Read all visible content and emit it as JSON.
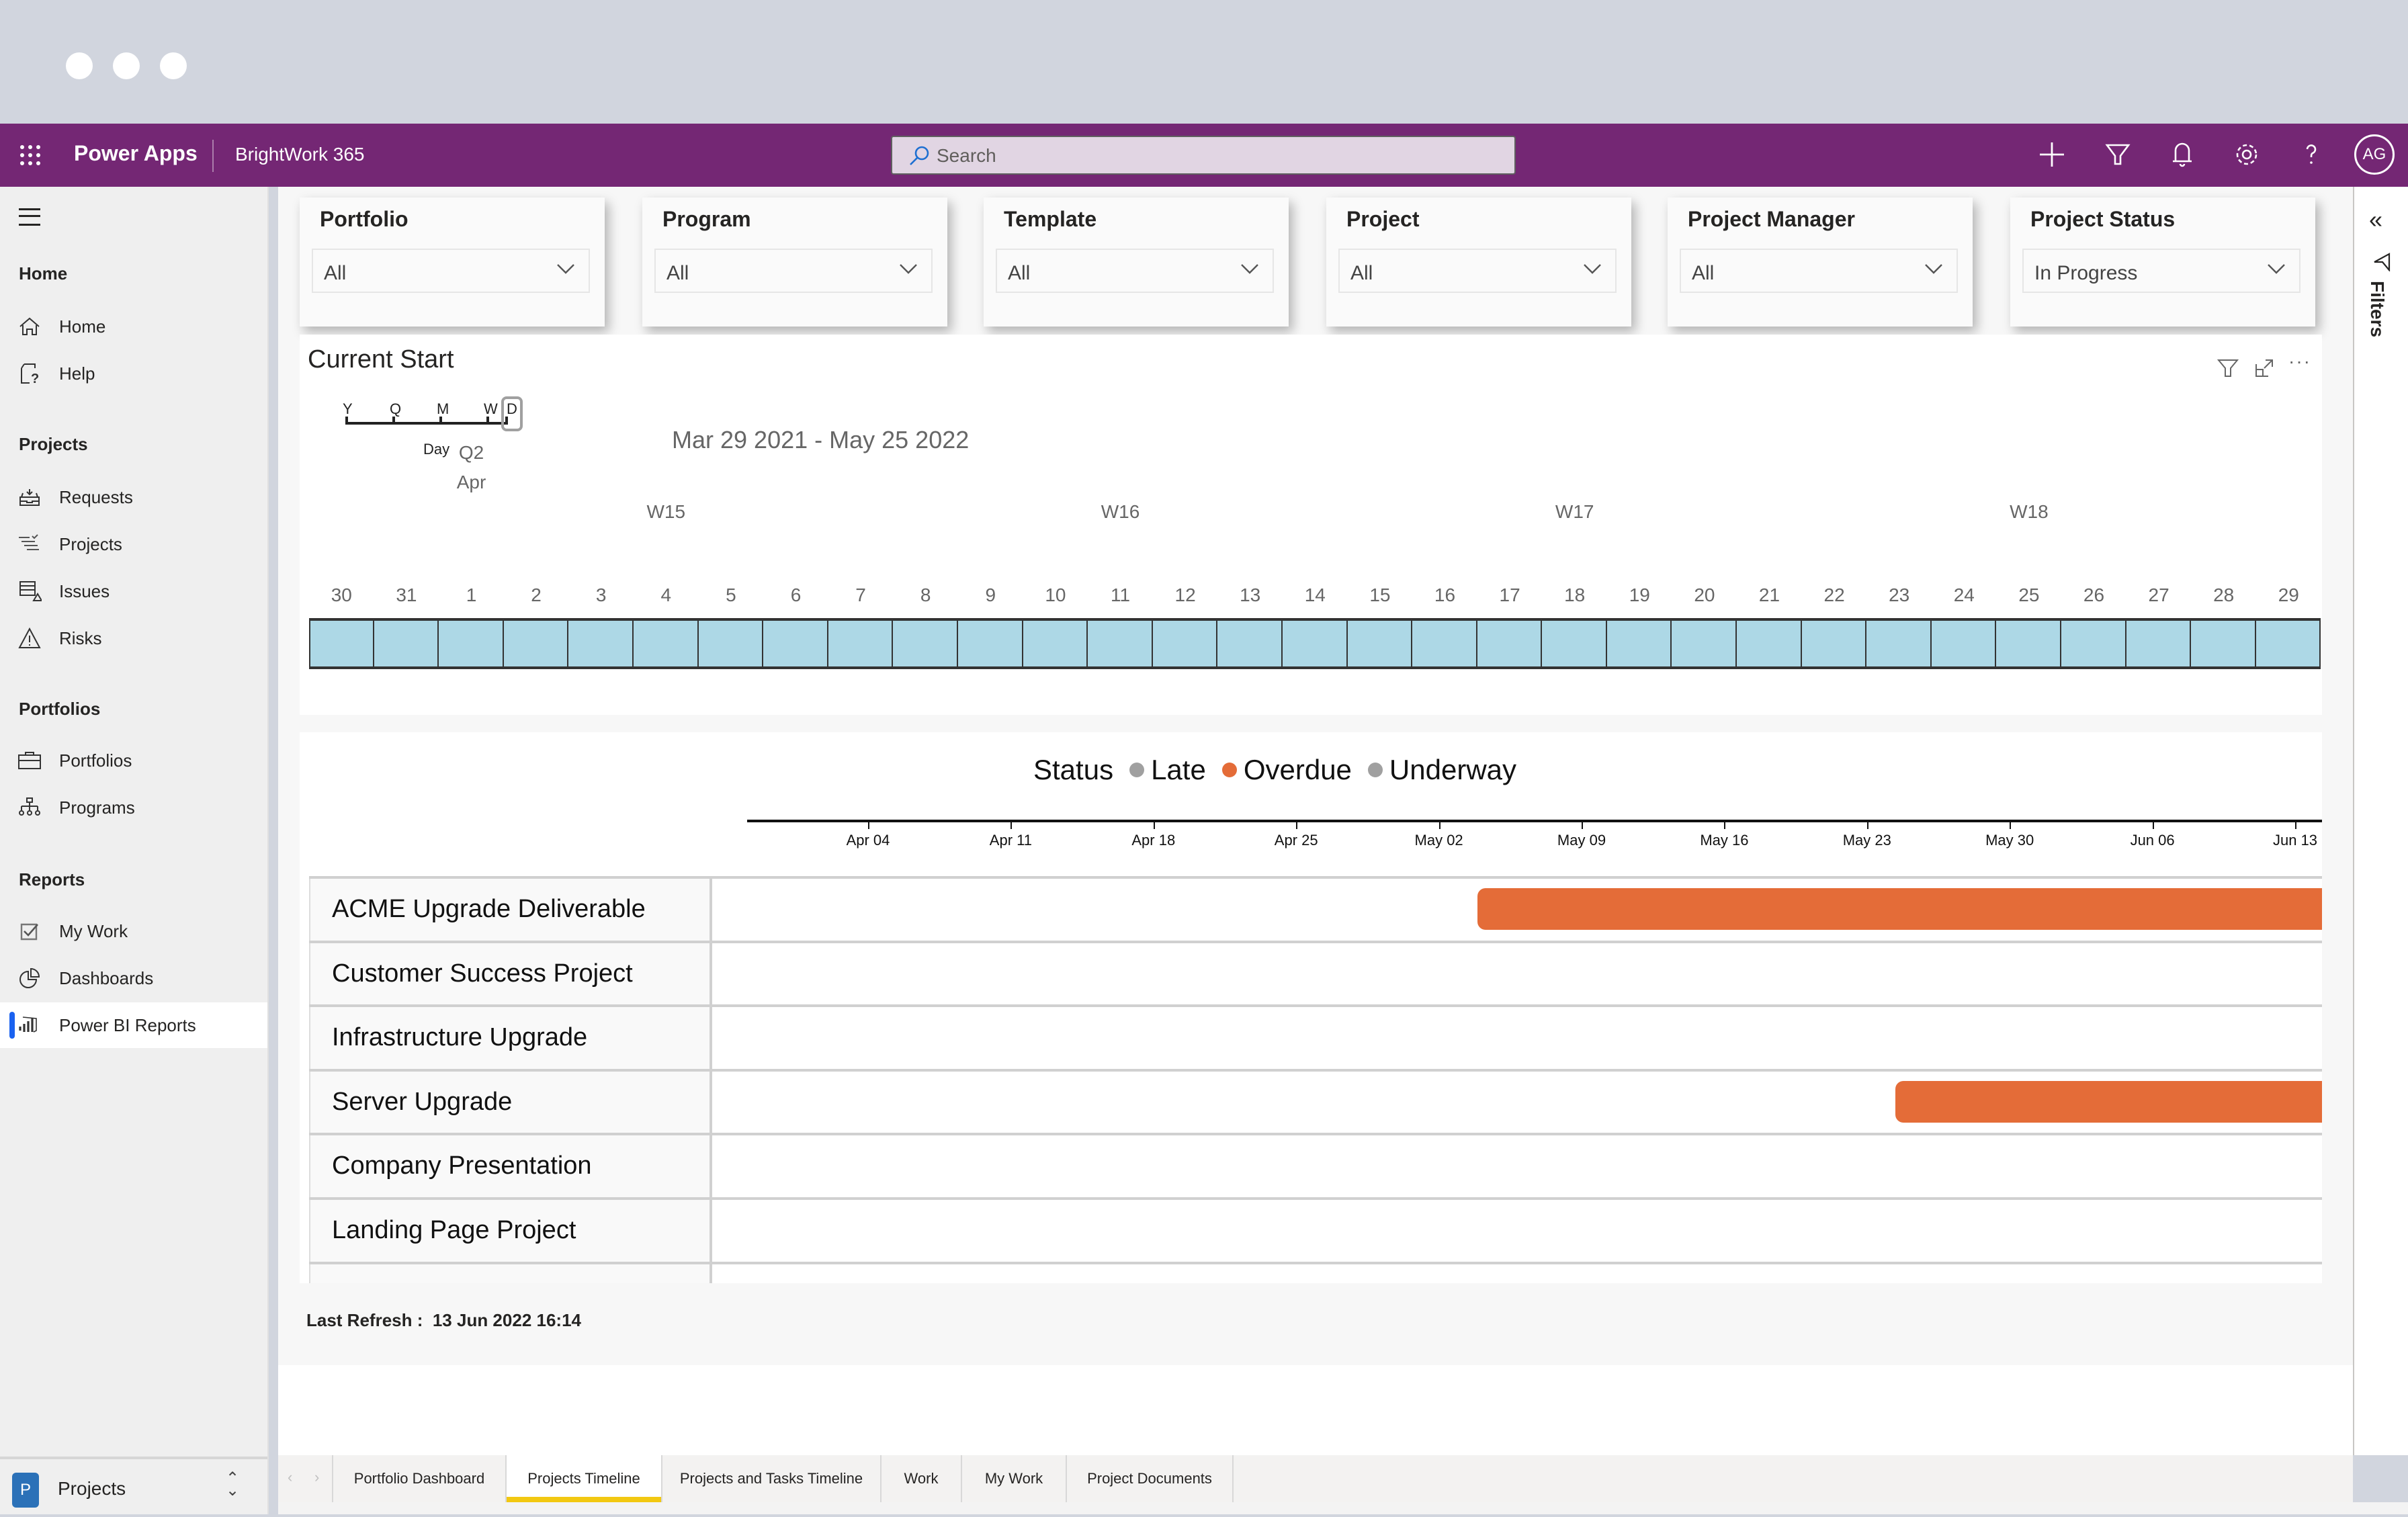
{
  "window": {
    "traffic_lights": [
      "close",
      "minimize",
      "maximize"
    ]
  },
  "appbar": {
    "app_name": "Power Apps",
    "environment": "BrightWork 365",
    "search_placeholder": "Search",
    "icons": [
      "add-icon",
      "filter-icon",
      "bell-icon",
      "gear-icon",
      "help-icon"
    ],
    "avatar_initials": "AG",
    "color": "#742774"
  },
  "sidebar": {
    "groups": [
      {
        "label": "Home",
        "items": [
          {
            "label": "Home",
            "icon": "home-icon"
          },
          {
            "label": "Help",
            "icon": "help-doc-icon"
          }
        ]
      },
      {
        "label": "Projects",
        "items": [
          {
            "label": "Requests",
            "icon": "inbox-icon"
          },
          {
            "label": "Projects",
            "icon": "list-check-icon"
          },
          {
            "label": "Issues",
            "icon": "issue-icon"
          },
          {
            "label": "Risks",
            "icon": "warning-icon"
          }
        ]
      },
      {
        "label": "Portfolios",
        "items": [
          {
            "label": "Portfolios",
            "icon": "briefcase-icon"
          },
          {
            "label": "Programs",
            "icon": "org-chart-icon"
          }
        ]
      },
      {
        "label": "Reports",
        "items": [
          {
            "label": "My Work",
            "icon": "checkbox-icon"
          },
          {
            "label": "Dashboards",
            "icon": "pie-chart-icon"
          },
          {
            "label": "Power BI Reports",
            "icon": "powerbi-icon",
            "active": true
          }
        ]
      }
    ],
    "footer": {
      "badge": "P",
      "label": "Projects"
    }
  },
  "slicers": [
    {
      "title": "Portfolio",
      "value": "All"
    },
    {
      "title": "Program",
      "value": "All"
    },
    {
      "title": "Template",
      "value": "All"
    },
    {
      "title": "Project",
      "value": "All"
    },
    {
      "title": "Project Manager",
      "value": "All"
    },
    {
      "title": "Project Status",
      "value": "In Progress"
    }
  ],
  "filters_pane": {
    "label": "Filters"
  },
  "current_start": {
    "title": "Current Start",
    "scale": {
      "options": [
        "Y",
        "Q",
        "M",
        "W",
        "D"
      ],
      "selected": "D",
      "selected_label": "Day"
    },
    "date_range": "Mar 29 2021 - May 25 2022",
    "quarter_label": "Q2",
    "month_label": "Apr",
    "week_labels": [
      {
        "label": "W15",
        "at_day": "4"
      },
      {
        "label": "W16",
        "at_day": "11"
      },
      {
        "label": "W17",
        "at_day": "18"
      },
      {
        "label": "W18",
        "at_day": "25"
      }
    ],
    "days": [
      "30",
      "31",
      "1",
      "2",
      "3",
      "4",
      "5",
      "6",
      "7",
      "8",
      "9",
      "10",
      "11",
      "12",
      "13",
      "14",
      "15",
      "16",
      "17",
      "18",
      "19",
      "20",
      "21",
      "22",
      "23",
      "24",
      "25",
      "26",
      "27",
      "28",
      "29"
    ],
    "cell_color": "#add8e6"
  },
  "gantt": {
    "legend_title": "Status",
    "legend": [
      {
        "label": "Late",
        "color": "#a0a0a0"
      },
      {
        "label": "Overdue",
        "color": "#e46c38"
      },
      {
        "label": "Underway",
        "color": "#a0a0a0"
      }
    ],
    "axis_ticks": [
      "Apr 04",
      "Apr 11",
      "Apr 18",
      "Apr 25",
      "May 02",
      "May 09",
      "May 16",
      "May 23",
      "May 30",
      "Jun 06",
      "Jun 13"
    ],
    "rows": [
      {
        "name": "ACME Upgrade Deliverable",
        "bar": {
          "status": "Overdue",
          "start_weeks_from_apr04": 4.27,
          "extends_past_view": true
        }
      },
      {
        "name": "Customer Success Project",
        "bar": null
      },
      {
        "name": "Infrastructure Upgrade",
        "bar": null
      },
      {
        "name": "Server Upgrade",
        "bar": {
          "status": "Overdue",
          "start_weeks_from_apr04": 7.2,
          "extends_past_view": true
        }
      },
      {
        "name": "Company Presentation",
        "bar": null
      },
      {
        "name": "Landing Page Project",
        "bar": null
      }
    ]
  },
  "footer": {
    "last_refresh_label": "Last Refresh :",
    "last_refresh_value": "13 Jun 2022 16:14"
  },
  "tabs": {
    "items": [
      "Portfolio Dashboard",
      "Projects Timeline",
      "Projects and Tasks Timeline",
      "Work",
      "My Work",
      "Project Documents"
    ],
    "active": "Projects Timeline"
  }
}
